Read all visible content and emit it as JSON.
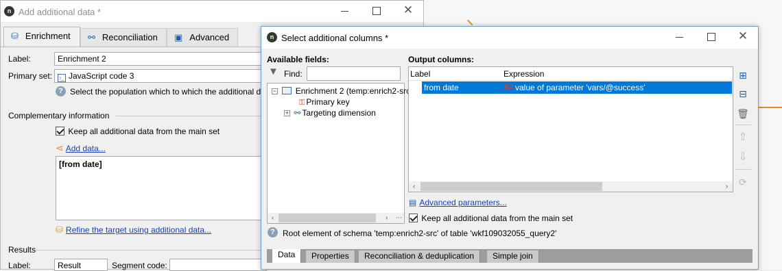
{
  "main_window": {
    "title": "Add additional data *",
    "tabs": [
      {
        "label": "Enrichment",
        "icon": "enrichment-icon"
      },
      {
        "label": "Reconciliation",
        "icon": "reconciliation-icon"
      },
      {
        "label": "Advanced",
        "icon": "advanced-icon"
      }
    ],
    "label_caption": "Label:",
    "label_value": "Enrichment 2",
    "primary_set_caption": "Primary set:",
    "primary_set_value": "JavaScript code 3",
    "help_text": "Select the population which to which the additional d",
    "complementary_title": "Complementary information",
    "keep_all_label": "Keep all additional data from the main set",
    "keep_all_checked": true,
    "add_data_link": "Add data...",
    "data_item": "[from date]",
    "refine_link": "Refine the target using additional data...",
    "results_title": "Results",
    "results_label_caption": "Label:",
    "results_label_value": "Result",
    "segment_code_caption": "Segment code:"
  },
  "dialog": {
    "title": "Select additional columns *",
    "available_fields_title": "Available fields:",
    "find_caption": "Find:",
    "tree": {
      "root": "Enrichment 2 (temp:enrich2-src",
      "child1": "Primary key",
      "child2": "Targeting dimension"
    },
    "output_title": "Output columns:",
    "col_label": "Label",
    "col_expression": "Expression",
    "rows": [
      {
        "label": "from date",
        "expression": "value of parameter 'vars/@success'"
      }
    ],
    "advanced_link": "Advanced parameters...",
    "keep_all_label": "Keep all additional data from the main set",
    "keep_all_checked": true,
    "root_info": "Root element of schema 'temp:enrich2-src' of table 'wkf109032055_query2'",
    "bottom_tabs": [
      "Data",
      "Properties",
      "Reconciliation & deduplication",
      "Simple join"
    ]
  },
  "colors": {
    "accent_orange": "#f08a24",
    "selection_blue": "#0078d7",
    "link_blue": "#1a3fb5"
  }
}
